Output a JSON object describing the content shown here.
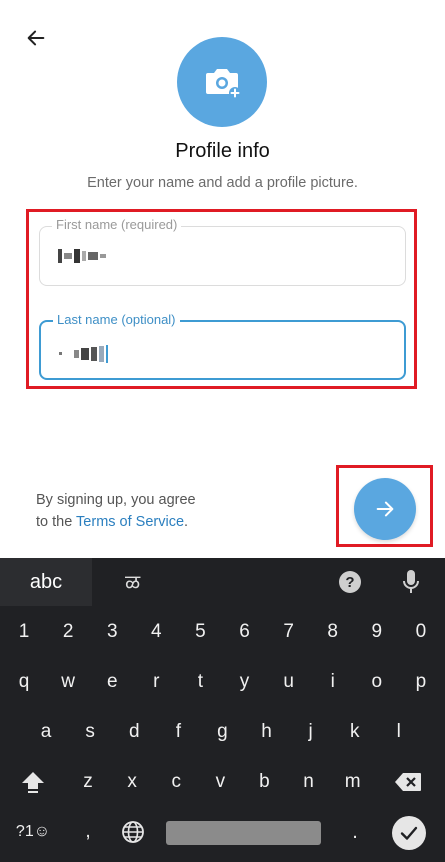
{
  "header": {
    "title": "Profile info",
    "subtitle": "Enter your name and add a profile picture."
  },
  "form": {
    "first_name_label": "First name (required)",
    "last_name_label": "Last name (optional)"
  },
  "footer": {
    "terms_prefix": "By signing up, you agree",
    "terms_to": "to the ",
    "terms_link": "Terms of Service",
    "terms_suffix": "."
  },
  "keyboard": {
    "tab_abc": "abc",
    "tab_script": "ळ",
    "help": "?",
    "numbers": [
      "1",
      "2",
      "3",
      "4",
      "5",
      "6",
      "7",
      "8",
      "9",
      "0"
    ],
    "row1": [
      "q",
      "w",
      "e",
      "r",
      "t",
      "y",
      "u",
      "i",
      "o",
      "p"
    ],
    "row2": [
      "a",
      "s",
      "d",
      "f",
      "g",
      "h",
      "j",
      "k",
      "l"
    ],
    "row3": [
      "z",
      "x",
      "c",
      "v",
      "b",
      "n",
      "m"
    ],
    "symbols_key": "?1☺",
    "comma": ",",
    "period": "."
  },
  "colors": {
    "accent": "#5aa7e0",
    "focus_border": "#3e9bd3",
    "link": "#2b7fbf",
    "highlight": "#e01b24",
    "keyboard_bg": "#202124"
  },
  "icons": {
    "back": "arrow-left-icon",
    "avatar": "camera-add-icon",
    "next": "arrow-right-icon",
    "mic": "microphone-icon",
    "globe": "globe-icon",
    "shift": "shift-icon",
    "backspace": "backspace-icon",
    "enter": "checkmark-icon"
  }
}
